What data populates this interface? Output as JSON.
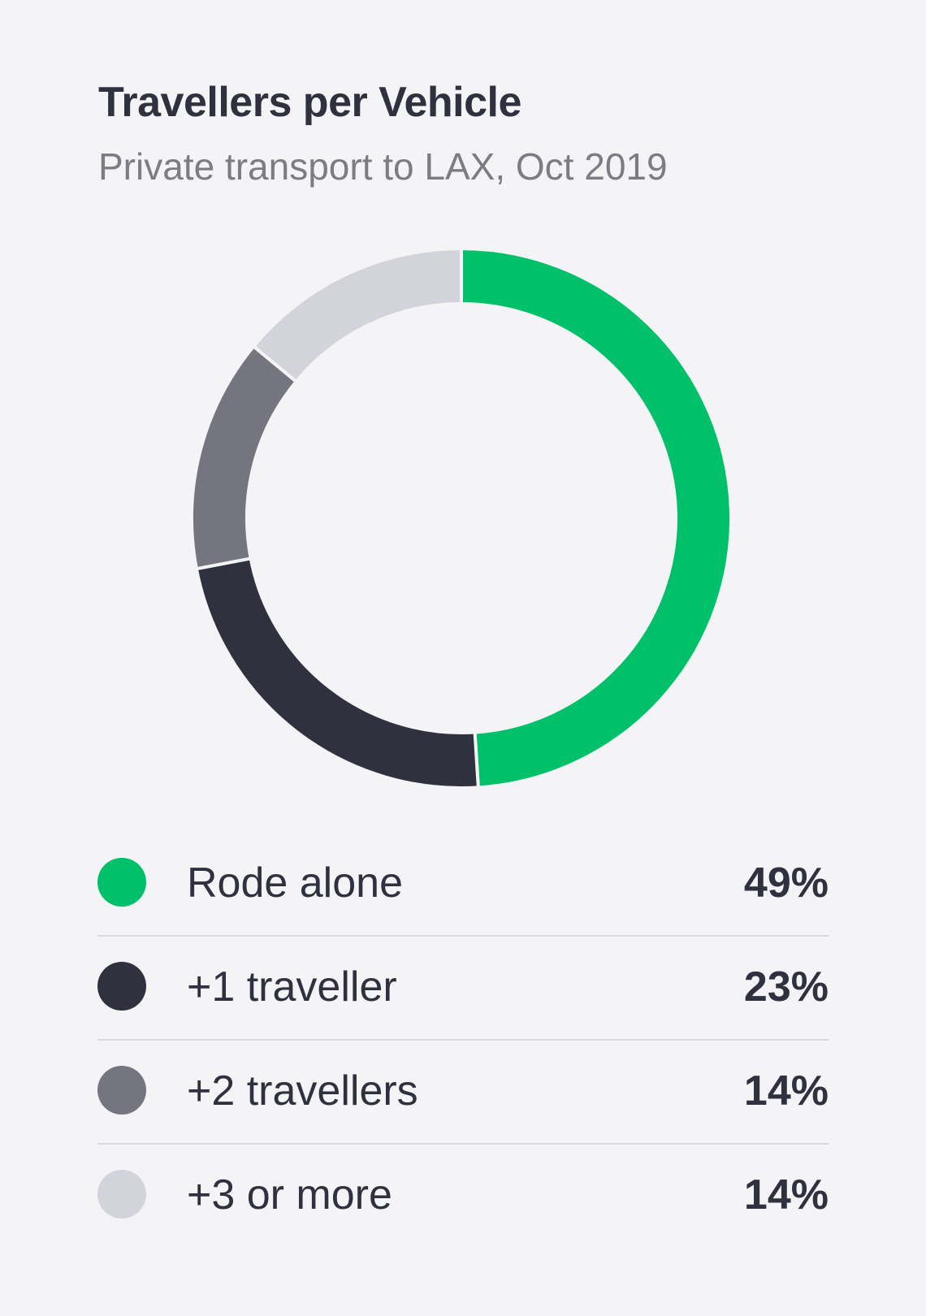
{
  "chart_data": {
    "type": "pie",
    "title": "Travellers per Vehicle",
    "subtitle": "Private transport to LAX, Oct 2019",
    "categories": [
      "Rode alone",
      "+1 traveller",
      "+2 travellers",
      "+3 or more"
    ],
    "values": [
      49,
      23,
      14,
      14
    ],
    "value_labels": [
      "49%",
      "23%",
      "14%",
      "14%"
    ],
    "colors": [
      "#00c16a",
      "#2f313e",
      "#74757f",
      "#d3d4db"
    ],
    "donut": true,
    "legend_position": "bottom"
  }
}
